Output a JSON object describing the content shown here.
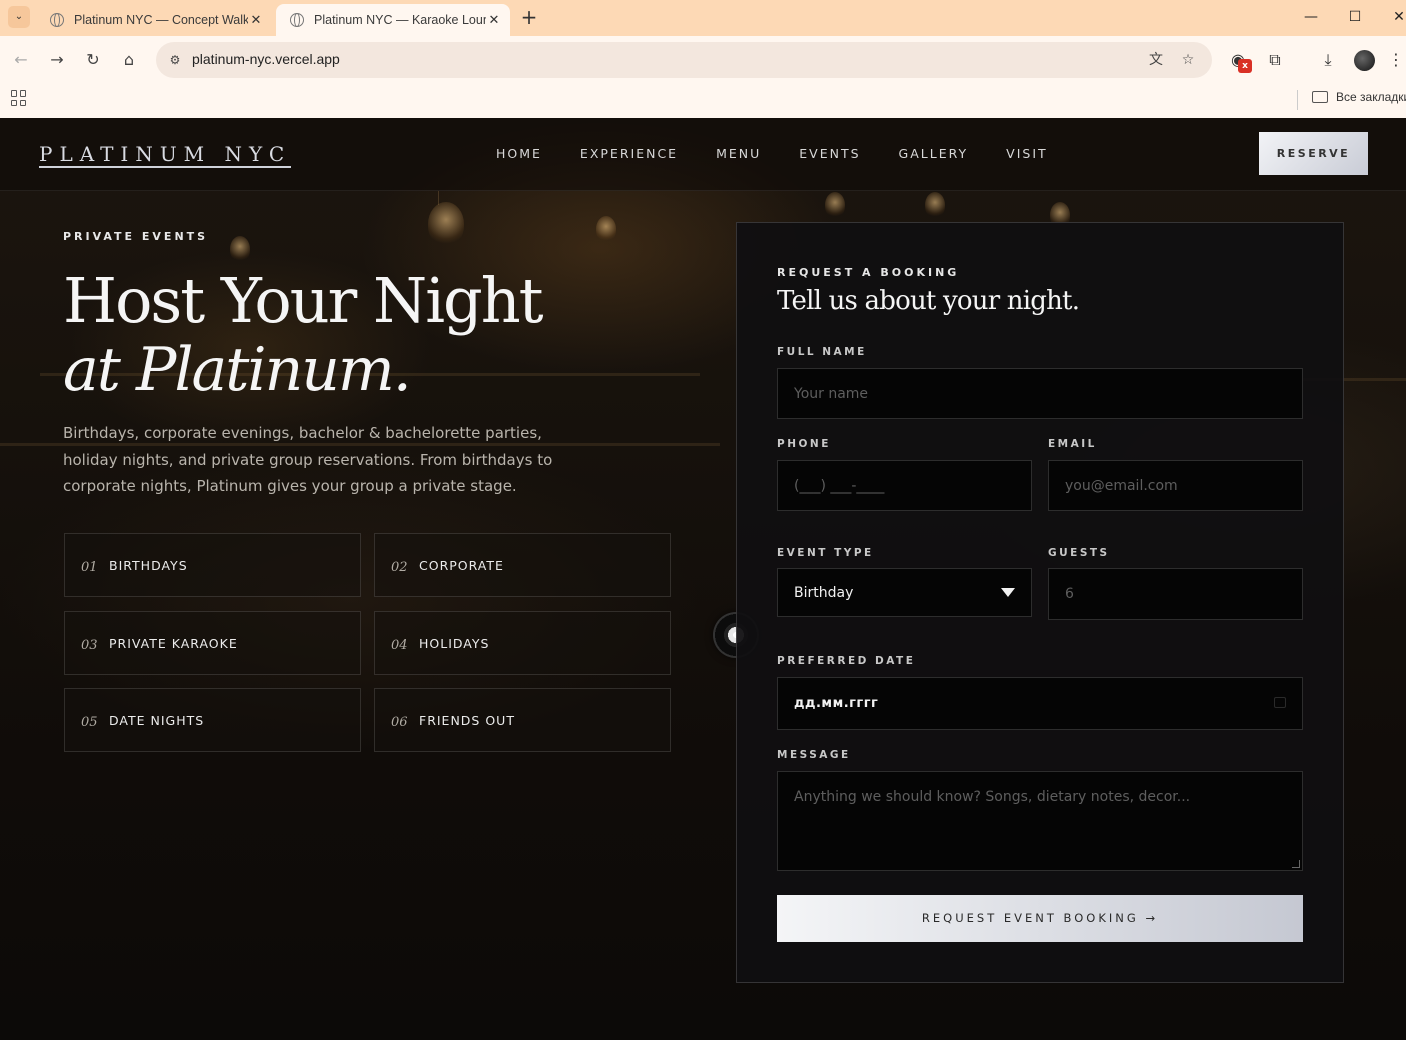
{
  "browser": {
    "tabs": [
      {
        "title": "Platinum NYC — Concept Walk",
        "close": "✕"
      },
      {
        "title": "Platinum NYC — Karaoke Loung",
        "close": "✕"
      }
    ],
    "new_tab": "+",
    "window_controls": {
      "minimize": "—",
      "maximize": "☐",
      "close": "✕"
    },
    "url": "platinum-nyc.vercel.app",
    "bookmarks_folder": "Все закладки"
  },
  "site": {
    "logo": "PLATINUM NYC",
    "nav": [
      "HOME",
      "EXPERIENCE",
      "MENU",
      "EVENTS",
      "GALLERY",
      "VISIT"
    ],
    "reserve": "RESERVE"
  },
  "hero": {
    "eyebrow": "PRIVATE EVENTS",
    "title_line1": "Host Your Night",
    "title_line2": "at Platinum.",
    "lead": "Birthdays, corporate evenings, bachelor & bachelorette parties, holiday nights, and private group reservations. From birthdays to corporate nights, Platinum gives your group a private stage."
  },
  "categories": [
    {
      "num": "01",
      "label": "BIRTHDAYS"
    },
    {
      "num": "02",
      "label": "CORPORATE"
    },
    {
      "num": "03",
      "label": "PRIVATE KARAOKE"
    },
    {
      "num": "04",
      "label": "HOLIDAYS"
    },
    {
      "num": "05",
      "label": "DATE NIGHTS"
    },
    {
      "num": "06",
      "label": "FRIENDS OUT"
    }
  ],
  "form": {
    "kicker": "REQUEST A BOOKING",
    "title": "Tell us about your night.",
    "full_name": {
      "label": "FULL NAME",
      "placeholder": "Your name"
    },
    "phone": {
      "label": "PHONE",
      "placeholder": "(___) ___-____"
    },
    "email": {
      "label": "EMAIL",
      "placeholder": "you@email.com"
    },
    "event_type": {
      "label": "EVENT TYPE",
      "value": "Birthday"
    },
    "guests": {
      "label": "GUESTS",
      "placeholder": "6"
    },
    "date": {
      "label": "PREFERRED DATE",
      "value": "дд.мм.гггг"
    },
    "message": {
      "label": "MESSAGE",
      "placeholder": "Anything we should know? Songs, dietary notes, decor..."
    },
    "submit": "REQUEST EVENT BOOKING →"
  }
}
